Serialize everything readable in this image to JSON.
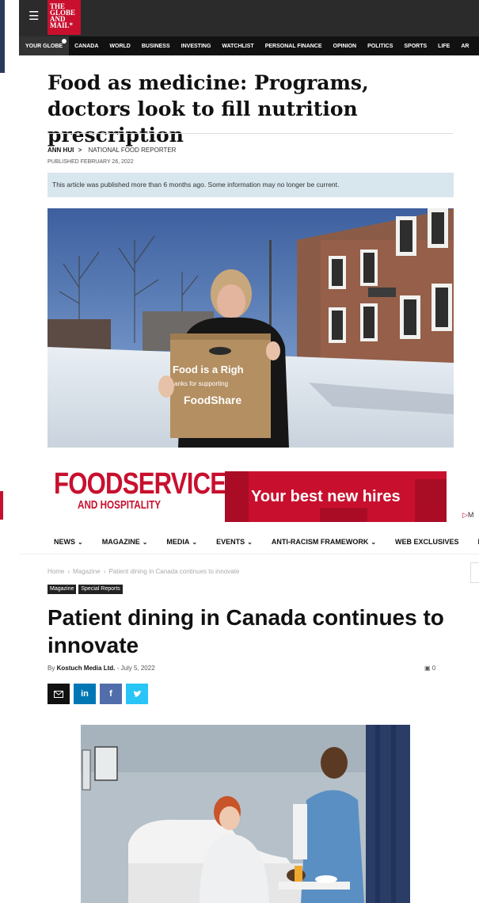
{
  "globe": {
    "logo_lines": [
      "THE",
      "GLOBE",
      "AND",
      "MAIL*"
    ],
    "nav": {
      "your_globe": "YOUR GLOBE",
      "items": [
        "CANADA",
        "WORLD",
        "BUSINESS",
        "INVESTING",
        "WATCHLIST",
        "PERSONAL FINANCE",
        "OPINION",
        "POLITICS",
        "SPORTS",
        "LIFE",
        "AR"
      ]
    },
    "headline": "Food as medicine: Programs, doctors look to fill nutrition prescription",
    "author": "ANN HUI",
    "author_chevron": ">",
    "author_role": "NATIONAL FOOD REPORTER",
    "published": "PUBLISHED FEBRUARY 26, 2022",
    "notice": "This article was published more than 6 months ago. Some information may no longer be current.",
    "photo_box_text": {
      "line1": "Food is a Righ",
      "line2": "anks for supporting",
      "line3": "FoodShare"
    }
  },
  "foodservice": {
    "logo_line1": "FOODSERVICE",
    "logo_line2": "AND HOSPITALITY",
    "ad_text": "Your best new hires",
    "ad_mark": "M",
    "nav_items": [
      {
        "label": "NEWS",
        "caret": "⌄"
      },
      {
        "label": "MAGAZINE",
        "caret": "⌄"
      },
      {
        "label": "MEDIA",
        "caret": "⌄"
      },
      {
        "label": "EVENTS",
        "caret": "⌄"
      },
      {
        "label": "ANTI-RACISM FRAMEWORK",
        "caret": "⌄"
      },
      {
        "label": "WEB EXCLUSIVES",
        "caret": ""
      },
      {
        "label": "BL",
        "caret": ""
      }
    ],
    "breadcrumb": [
      "Home",
      "Magazine",
      "Patient dining in Canada continues to innovate"
    ],
    "breadcrumb_sep": "›",
    "tags": [
      "Magazine",
      "Special Reports"
    ],
    "headline": "Patient dining in Canada continues to innovate",
    "by_prefix": "By",
    "author": "Kostuch Media Ltd.",
    "date_sep": "-",
    "date": "July 5, 2022",
    "comment_count": "0",
    "share": {
      "mail_icon": "envelope-icon",
      "linkedin": "in",
      "facebook": "f",
      "twitter_icon": "twitter-bird-icon"
    }
  },
  "colors": {
    "globe_red": "#c8102e",
    "globe_bar": "#2b2b2b",
    "notice_bg": "#d8e6ee",
    "foodservice_red": "#c8102e",
    "linkedin": "#0077b5",
    "facebook": "#516eab",
    "twitter": "#29c5f6"
  }
}
